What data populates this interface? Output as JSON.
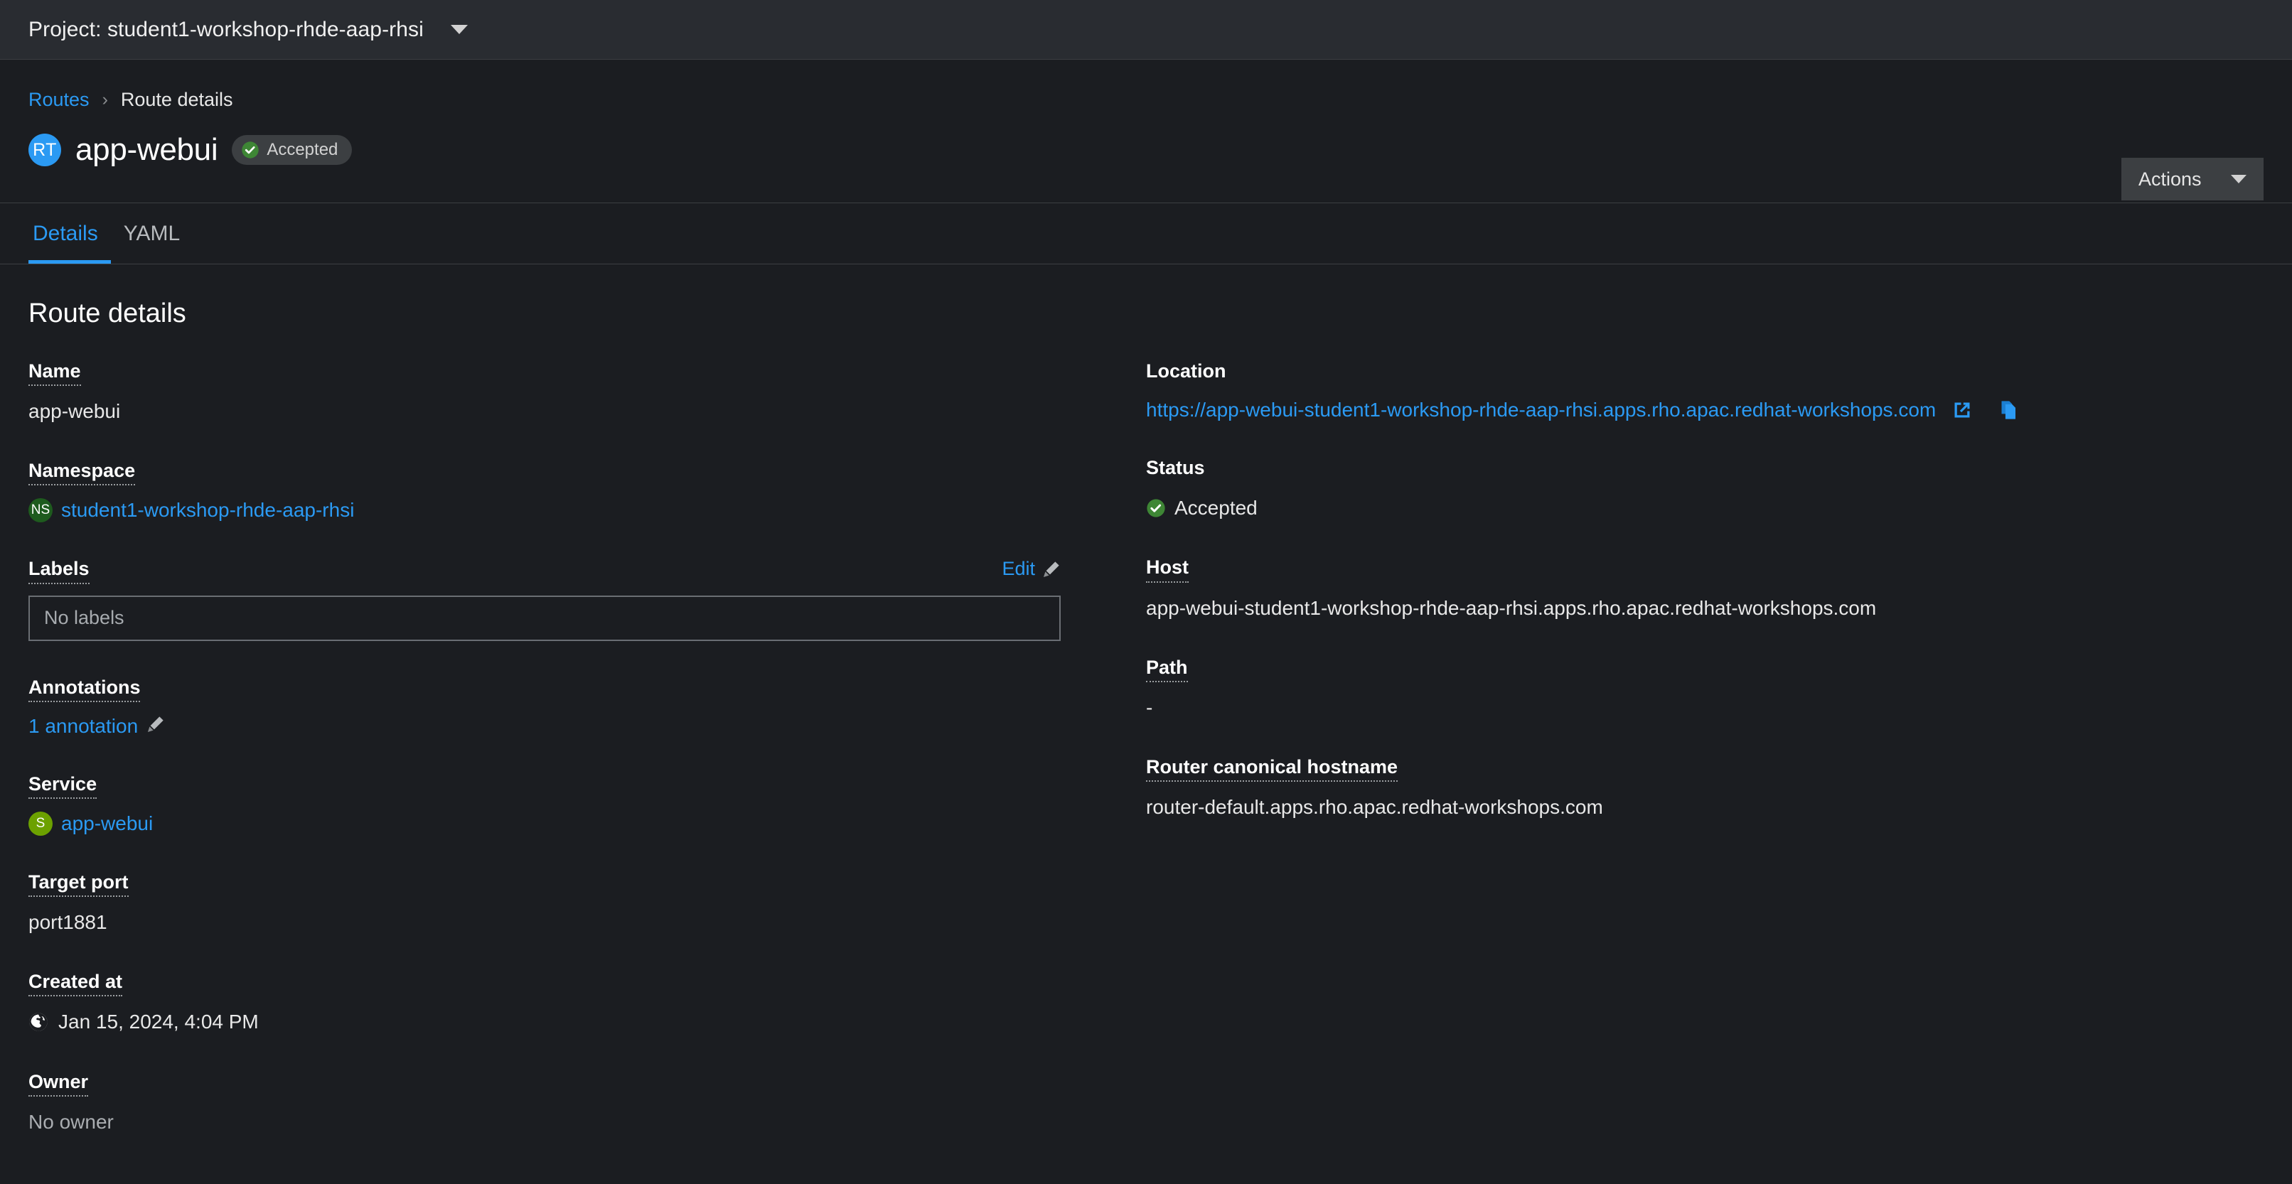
{
  "colors": {
    "accent_blue": "#2b9af3",
    "badge_blue": "#2b9af3",
    "status_green": "#3e8635",
    "ns_green": "#1e5b1e",
    "service_green": "#6ca100",
    "bg": "#1b1d21",
    "bar_bg": "#292c31",
    "border": "#3c3f42"
  },
  "project_bar": {
    "label": "Project: student1-workshop-rhde-aap-rhsi",
    "caret_icon": "chevron-down-icon"
  },
  "breadcrumb": {
    "parent": "Routes",
    "separator": "›",
    "current": "Route details"
  },
  "header": {
    "resource_badge": "RT",
    "title": "app-webui",
    "status_label": "Accepted",
    "status_icon": "check-circle-icon",
    "actions_label": "Actions",
    "actions_caret_icon": "caret-down-icon"
  },
  "tabs": [
    {
      "label": "Details",
      "active": true
    },
    {
      "label": "YAML",
      "active": false
    }
  ],
  "main": {
    "section_title": "Route details",
    "left": {
      "name": {
        "label": "Name",
        "value": "app-webui"
      },
      "namespace": {
        "label": "Namespace",
        "badge": "NS",
        "value": "student1-workshop-rhde-aap-rhsi"
      },
      "labels": {
        "label": "Labels",
        "edit_label": "Edit",
        "edit_icon": "pencil-icon",
        "empty_text": "No labels"
      },
      "annotations": {
        "label": "Annotations",
        "value": "1 annotation",
        "edit_icon": "pencil-icon"
      },
      "service": {
        "label": "Service",
        "badge": "S",
        "value": "app-webui"
      },
      "target_port": {
        "label": "Target port",
        "value": "port1881"
      },
      "created_at": {
        "label": "Created at",
        "icon": "globe-icon",
        "value": "Jan 15, 2024, 4:04 PM"
      },
      "owner": {
        "label": "Owner",
        "value": "No owner"
      }
    },
    "right": {
      "location": {
        "label": "Location",
        "value": "https://app-webui-student1-workshop-rhde-aap-rhsi.apps.rho.apac.redhat-workshops.com",
        "external_icon": "external-link-icon",
        "copy_icon": "copy-icon"
      },
      "status": {
        "label": "Status",
        "value": "Accepted",
        "icon": "check-circle-icon"
      },
      "host": {
        "label": "Host",
        "value": "app-webui-student1-workshop-rhde-aap-rhsi.apps.rho.apac.redhat-workshops.com"
      },
      "path": {
        "label": "Path",
        "value": "-"
      },
      "router_hostname": {
        "label": "Router canonical hostname",
        "value": "router-default.apps.rho.apac.redhat-workshops.com"
      }
    }
  }
}
